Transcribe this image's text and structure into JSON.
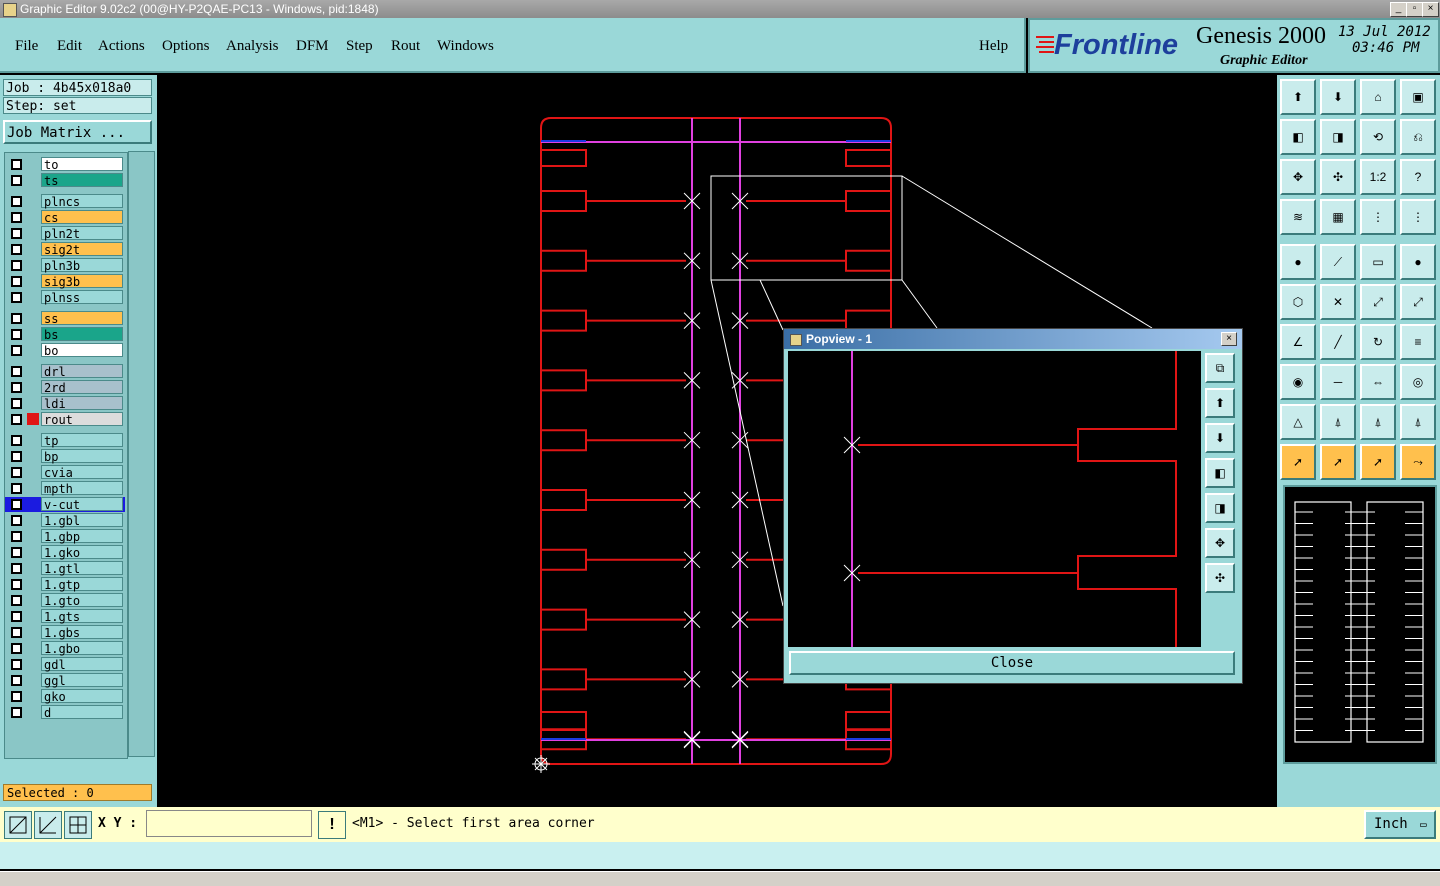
{
  "window": {
    "title": "Graphic Editor 9.02c2 (00@HY-P2QAE-PC13 - Windows, pid:1848)"
  },
  "menus": [
    "File",
    "Edit",
    "Actions",
    "Options",
    "Analysis",
    "DFM",
    "Step",
    "Rout",
    "Windows"
  ],
  "help_label": "Help",
  "brand": {
    "logo": "Frontline",
    "product": "Genesis 2000",
    "subtitle": "Graphic Editor",
    "date": "13 Jul 2012",
    "time": "03:46 PM"
  },
  "job": {
    "job_label": "Job : 4b45x018a0",
    "step_label": "Step: set",
    "matrix_button": "Job Matrix ..."
  },
  "layers": [
    {
      "name": "to",
      "color": "#ffffff",
      "group": 1
    },
    {
      "name": "ts",
      "color": "#1aa58a",
      "group": 1
    },
    {
      "name": "plncs",
      "color": "#9ad8d8",
      "group": 2
    },
    {
      "name": "cs",
      "color": "#ffc04d",
      "group": 2
    },
    {
      "name": "pln2t",
      "color": "#9ad8d8",
      "group": 2
    },
    {
      "name": "sig2t",
      "color": "#ffc04d",
      "group": 2
    },
    {
      "name": "pln3b",
      "color": "#9ad8d8",
      "group": 2
    },
    {
      "name": "sig3b",
      "color": "#ffc04d",
      "group": 2
    },
    {
      "name": "plnss",
      "color": "#9ad8d8",
      "group": 2
    },
    {
      "name": "ss",
      "color": "#ffc04d",
      "group": 3
    },
    {
      "name": "bs",
      "color": "#1aa58a",
      "group": 3
    },
    {
      "name": "bo",
      "color": "#ffffff",
      "group": 3
    },
    {
      "name": "drl",
      "color": "#a8c0cc",
      "group": 4
    },
    {
      "name": "2rd",
      "color": "#a8c0cc",
      "group": 4
    },
    {
      "name": "ldi",
      "color": "#a8c0cc",
      "group": 4
    },
    {
      "name": "rout",
      "color": "#dcdcdc",
      "group": 4
    },
    {
      "name": "tp",
      "color": "#9ad8d8",
      "group": 5
    },
    {
      "name": "bp",
      "color": "#9ad8d8",
      "group": 5
    },
    {
      "name": "cvia",
      "color": "#9ad8d8",
      "group": 5
    },
    {
      "name": "mpth",
      "color": "#9ad8d8",
      "group": 5
    },
    {
      "name": "v-cut",
      "color": "#9ad8d8",
      "group": 5
    },
    {
      "name": "1.gbl",
      "color": "#9ad8d8",
      "group": 5
    },
    {
      "name": "1.gbp",
      "color": "#9ad8d8",
      "group": 5
    },
    {
      "name": "1.gko",
      "color": "#9ad8d8",
      "group": 5
    },
    {
      "name": "1.gtl",
      "color": "#9ad8d8",
      "group": 5
    },
    {
      "name": "1.gtp",
      "color": "#9ad8d8",
      "group": 5
    },
    {
      "name": "1.gto",
      "color": "#9ad8d8",
      "group": 5
    },
    {
      "name": "1.gts",
      "color": "#9ad8d8",
      "group": 5
    },
    {
      "name": "1.gbs",
      "color": "#9ad8d8",
      "group": 5
    },
    {
      "name": "1.gbo",
      "color": "#9ad8d8",
      "group": 5
    },
    {
      "name": "gdl",
      "color": "#9ad8d8",
      "group": 5
    },
    {
      "name": "ggl",
      "color": "#9ad8d8",
      "group": 5
    },
    {
      "name": "gko",
      "color": "#9ad8d8",
      "group": 5
    },
    {
      "name": "d",
      "color": "#9ad8d8",
      "group": 5
    }
  ],
  "selected_label": "Selected : 0",
  "popview": {
    "title": "Popview - 1",
    "close_label": "Close"
  },
  "bottom": {
    "xy_label": "X Y :",
    "xy_value": "",
    "prompt": "<M1> - Select first area corner",
    "unit": "Inch"
  }
}
